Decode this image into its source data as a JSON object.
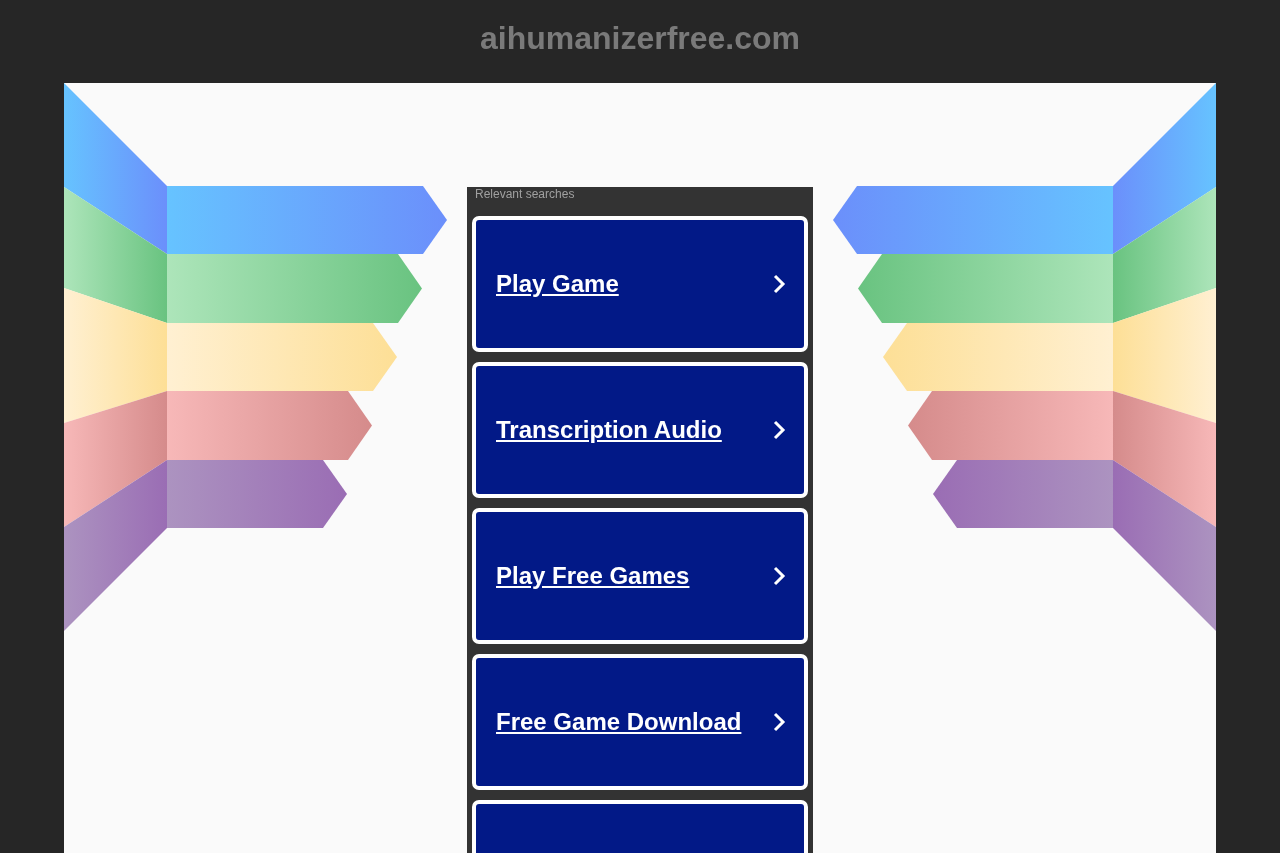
{
  "header": {
    "domain": "aihumanizerfree.com"
  },
  "searches": {
    "heading": "Relevant searches",
    "links": [
      {
        "label": "Play Game"
      },
      {
        "label": "Transcription Audio"
      },
      {
        "label": "Play Free Games"
      },
      {
        "label": "Free Game Download"
      }
    ],
    "more_below": true
  }
}
